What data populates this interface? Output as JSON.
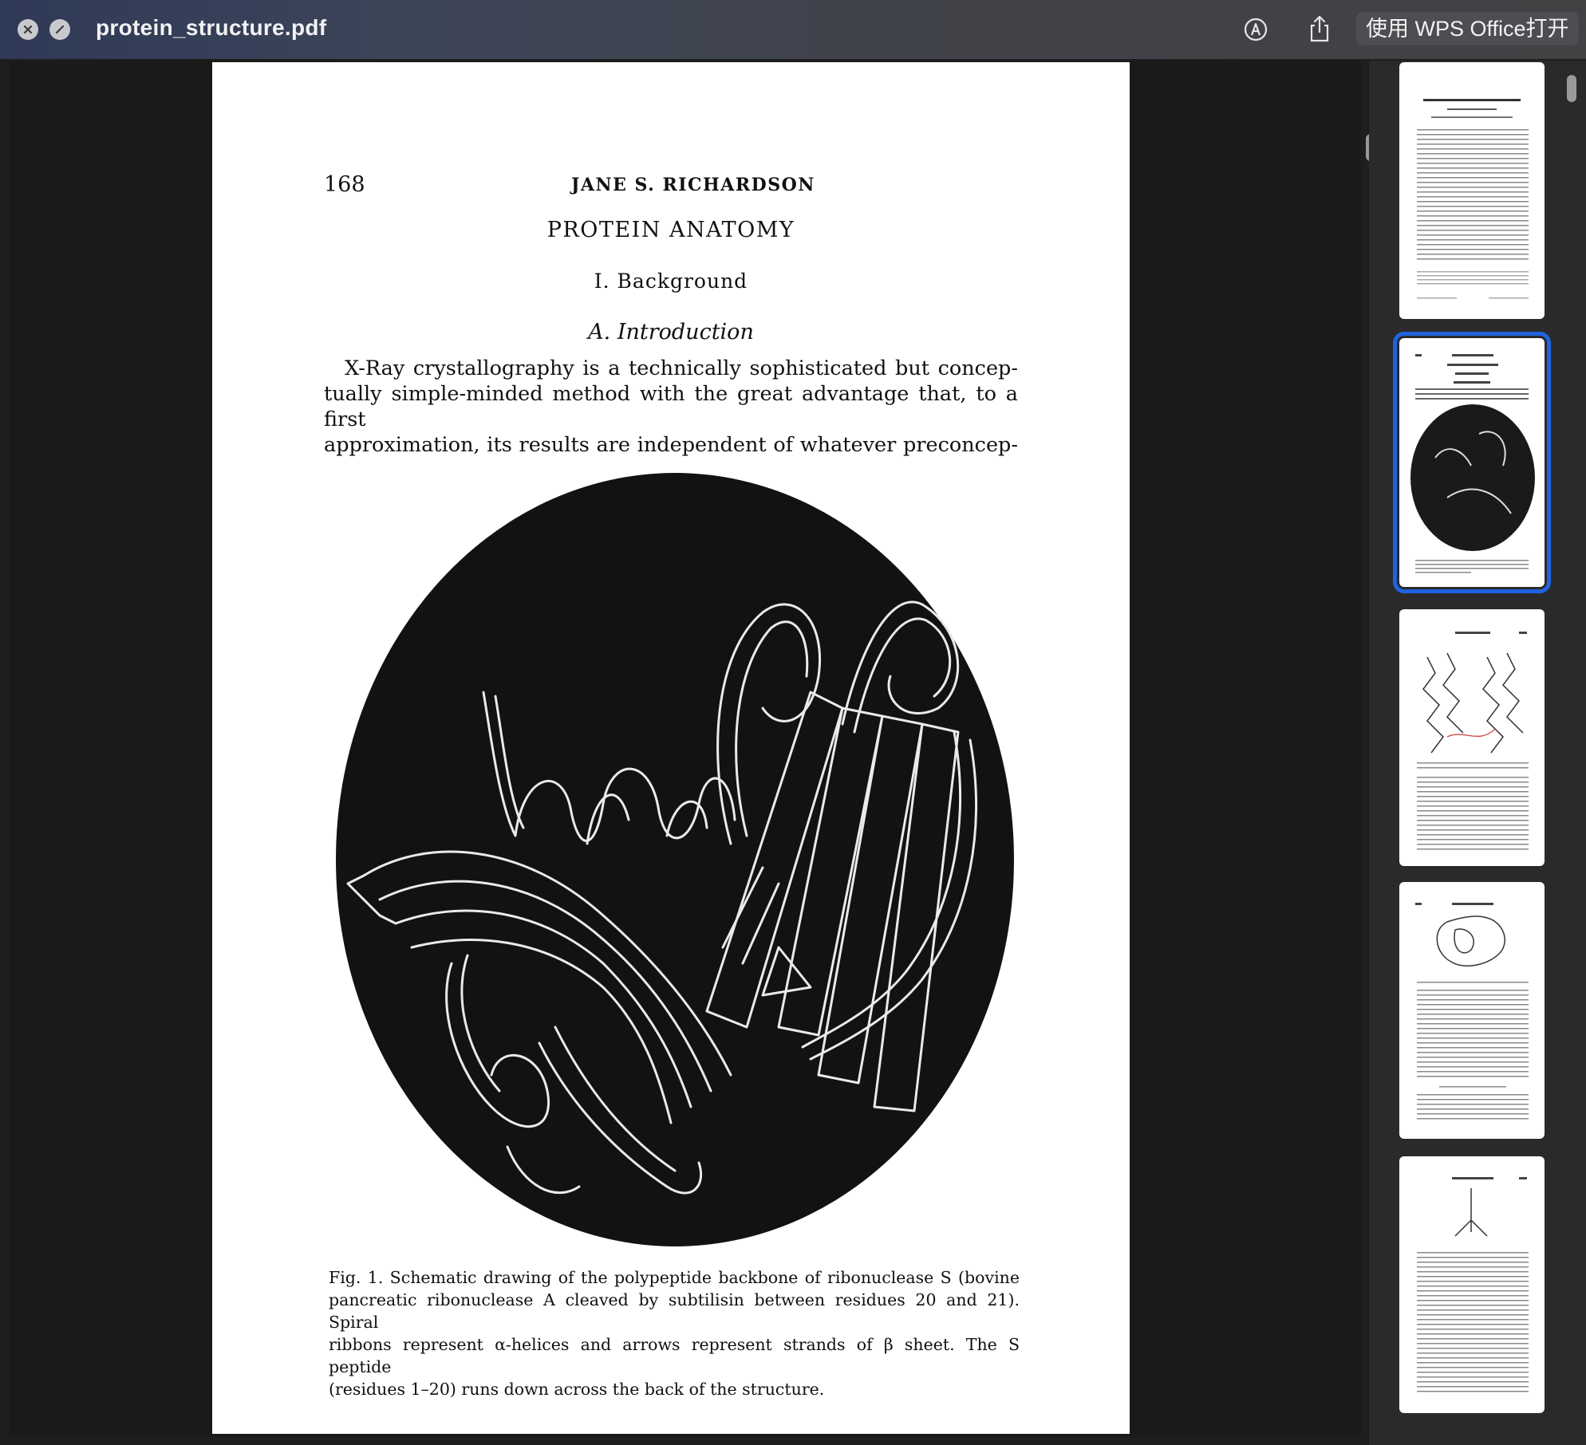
{
  "window": {
    "title": "protein_structure.pdf",
    "open_with_label": "使用 WPS Office打开",
    "icons": [
      "close-icon",
      "rotate-icon",
      "markup-icon",
      "share-icon"
    ]
  },
  "page": {
    "page_number": "168",
    "running_head": "JANE S. RICHARDSON",
    "heading": "PROTEIN ANATOMY",
    "section": "I. Background",
    "subsection": "A. Introduction",
    "body_lines": [
      "X-Ray crystallography is a technically sophisticated but concep-",
      "tually simple-minded method with the great advantage that, to a first",
      "approximation, its results are independent of whatever preconcep-"
    ],
    "caption_lines": [
      "Fig. 1.   Schematic drawing of the polypeptide backbone of ribonuclease S (bovine",
      "pancreatic ribonuclease A cleaved by subtilisin between residues 20 and 21).   Spiral",
      "ribbons represent α-helices and arrows represent strands of β sheet.   The S peptide",
      "(residues 1–20) runs down across the back of the structure."
    ]
  },
  "thumbnails": [
    {
      "index": 1,
      "selected": false
    },
    {
      "index": 2,
      "selected": true
    },
    {
      "index": 3,
      "selected": false
    },
    {
      "index": 4,
      "selected": false
    },
    {
      "index": 5,
      "selected": false
    }
  ],
  "colors": {
    "selection": "#1f63e0",
    "titlebar_left": "#2f3a57",
    "titlebar_right": "#414244"
  }
}
